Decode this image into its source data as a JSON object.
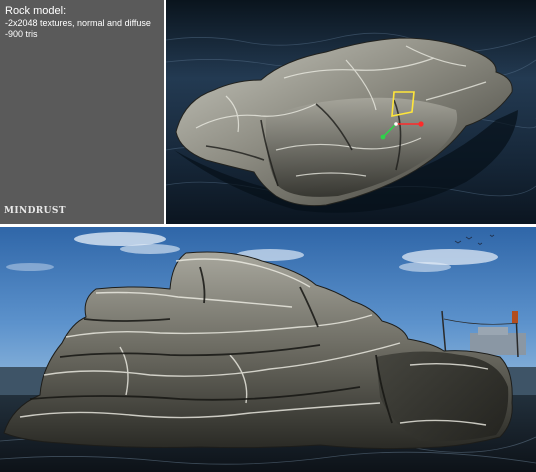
{
  "info_panel": {
    "title": "Rock model:",
    "specs": [
      "-2x2048 textures, normal and diffuse",
      "-900 tris"
    ],
    "logo_text": "MINDRUST"
  },
  "colors": {
    "panel_bg": "#5a5a5a",
    "panel_text": "#ffffff",
    "sky": "#4a82c0",
    "water": "#1e3144",
    "rock_light": "#b8b8ad",
    "rock_dark": "#2b2b27",
    "gizmo_x": "#ff2a2a",
    "gizmo_y": "#ffe63a",
    "gizmo_z": "#2fd14a"
  },
  "gizmo": {
    "axes": [
      "x-axis",
      "y-axis",
      "z-axis"
    ]
  }
}
